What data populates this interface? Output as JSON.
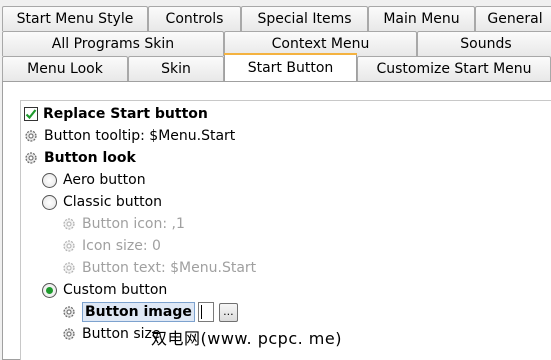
{
  "tabs": {
    "row1": [
      "Start Menu Style",
      "Controls",
      "Special Items",
      "Main Menu",
      "General"
    ],
    "row2": [
      "All Programs Skin",
      "Context Menu",
      "Sounds"
    ],
    "row3": [
      "Menu Look",
      "Skin",
      "Start Button",
      "Customize Start Menu"
    ],
    "active": "Start Button"
  },
  "settings": {
    "replace": {
      "label": "Replace Start button",
      "checked": true
    },
    "tooltip": {
      "label": "Button tooltip: $Menu.Start"
    },
    "look": {
      "label": "Button look"
    },
    "aero": {
      "label": "Aero button",
      "selected": false
    },
    "classic": {
      "label": "Classic button",
      "selected": false
    },
    "icon": {
      "label": "Button icon: ,1"
    },
    "iconsize": {
      "label": "Icon size: 0"
    },
    "text": {
      "label": "Button text: $Menu.Start"
    },
    "custom": {
      "label": "Custom button",
      "selected": true
    },
    "image": {
      "label": "Button image",
      "value": "",
      "browse_label": "..."
    },
    "size": {
      "label": "Button size"
    }
  },
  "watermark": "双电网(www. pcpc. me)",
  "colors": {
    "active_tab_accent": "#f4b240",
    "radio_selected": "#1e9a2d",
    "selection_bg": "#dfe8f5",
    "disabled_text": "#a0a0a0"
  }
}
